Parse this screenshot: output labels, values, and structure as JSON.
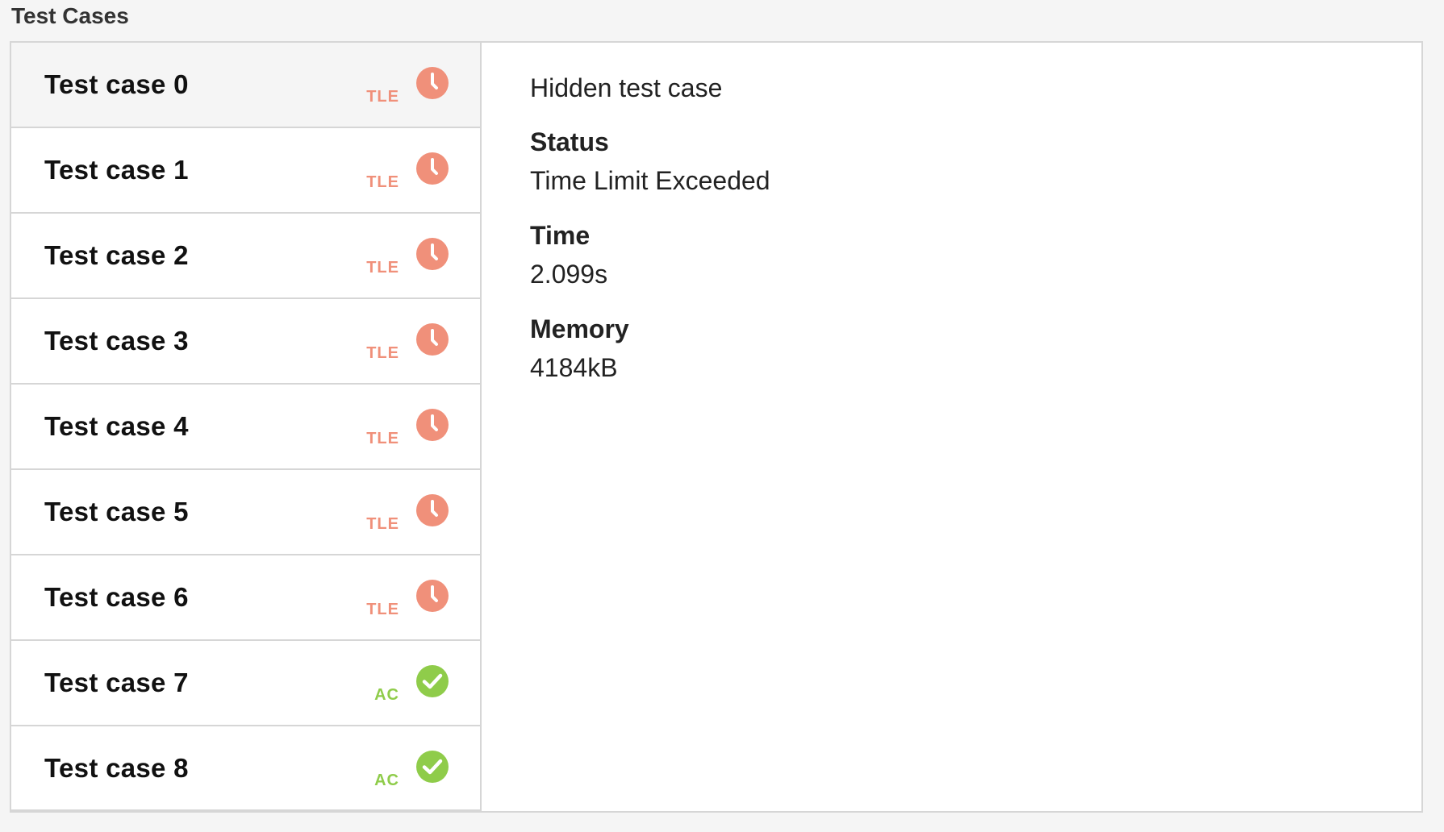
{
  "section_title": "Test Cases",
  "colors": {
    "tle": "#f0907a",
    "ac": "#8fcc4a",
    "border": "#d6d6d6"
  },
  "test_cases": [
    {
      "label": "Test case 0",
      "status": "TLE",
      "icon": "clock-icon",
      "selected": true
    },
    {
      "label": "Test case 1",
      "status": "TLE",
      "icon": "clock-icon",
      "selected": false
    },
    {
      "label": "Test case 2",
      "status": "TLE",
      "icon": "clock-icon",
      "selected": false
    },
    {
      "label": "Test case 3",
      "status": "TLE",
      "icon": "clock-icon",
      "selected": false
    },
    {
      "label": "Test case 4",
      "status": "TLE",
      "icon": "clock-icon",
      "selected": false
    },
    {
      "label": "Test case 5",
      "status": "TLE",
      "icon": "clock-icon",
      "selected": false
    },
    {
      "label": "Test case 6",
      "status": "TLE",
      "icon": "clock-icon",
      "selected": false
    },
    {
      "label": "Test case 7",
      "status": "AC",
      "icon": "check-circle-icon",
      "selected": false
    },
    {
      "label": "Test case 8",
      "status": "AC",
      "icon": "check-circle-icon",
      "selected": false
    }
  ],
  "detail": {
    "heading": "Hidden test case",
    "status_label": "Status",
    "status_value": "Time Limit Exceeded",
    "time_label": "Time",
    "time_value": "2.099s",
    "memory_label": "Memory",
    "memory_value": "4184kB"
  }
}
